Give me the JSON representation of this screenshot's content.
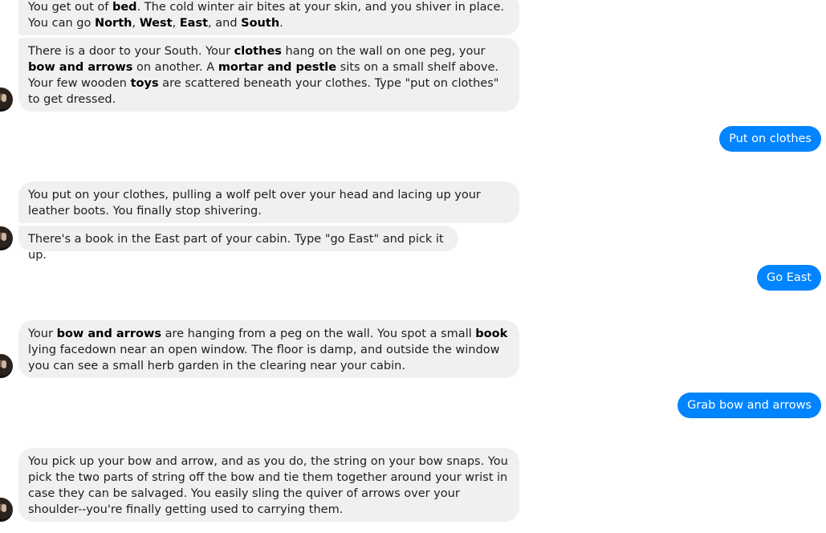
{
  "messages": [
    {
      "id": "m1",
      "from": "bot",
      "segments": [
        {
          "t": "You get out of "
        },
        {
          "t": "bed",
          "b": true
        },
        {
          "t": ". The cold winter air bites at your skin, and you shiver in place. You can go "
        },
        {
          "t": "North",
          "b": true
        },
        {
          "t": ", "
        },
        {
          "t": "West",
          "b": true
        },
        {
          "t": ", "
        },
        {
          "t": "East",
          "b": true
        },
        {
          "t": ", and "
        },
        {
          "t": "South",
          "b": true
        },
        {
          "t": "."
        }
      ]
    },
    {
      "id": "m2",
      "from": "bot",
      "segments": [
        {
          "t": "There is a door to your South. Your "
        },
        {
          "t": "clothes",
          "b": true
        },
        {
          "t": " hang on the wall on one peg, your "
        },
        {
          "t": "bow and arrows",
          "b": true
        },
        {
          "t": " on another. A "
        },
        {
          "t": "mortar and pestle",
          "b": true
        },
        {
          "t": " sits on a small shelf above.  Your few wooden "
        },
        {
          "t": "toys",
          "b": true
        },
        {
          "t": " are scattered beneath your clothes. Type \"put on clothes\" to get dressed."
        }
      ]
    },
    {
      "id": "u1",
      "from": "user",
      "text": "Put on clothes"
    },
    {
      "id": "m3",
      "from": "bot",
      "segments": [
        {
          "t": "You put on your clothes, pulling a wolf pelt over your head and lacing up your leather boots. You finally stop shivering."
        }
      ]
    },
    {
      "id": "m4",
      "from": "bot",
      "segments": [
        {
          "t": "There's a book in the East part of your cabin. Type \"go East\" and pick it up."
        }
      ]
    },
    {
      "id": "u2",
      "from": "user",
      "text": "Go East"
    },
    {
      "id": "m5",
      "from": "bot",
      "segments": [
        {
          "t": "Your "
        },
        {
          "t": "bow and arrows",
          "b": true
        },
        {
          "t": " are hanging from a peg on the wall. You spot a small "
        },
        {
          "t": "book",
          "b": true
        },
        {
          "t": " lying facedown near an open window. The floor is damp, and outside the window you can see a small herb garden in the clearing near your cabin."
        }
      ]
    },
    {
      "id": "u3",
      "from": "user",
      "text": "Grab bow and arrows"
    },
    {
      "id": "m6",
      "from": "bot",
      "segments": [
        {
          "t": "You pick up your bow and arrow, and as you do, the string on your bow snaps. You pick the two parts of string off the bow and tie them together around your wrist in case they can be salvaged. You easily sling the quiver of arrows over your shoulder--you're finally getting used to carrying them."
        }
      ]
    }
  ]
}
